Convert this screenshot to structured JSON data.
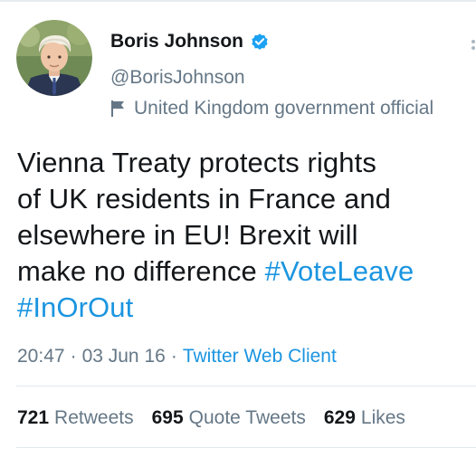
{
  "author": {
    "display_name": "Boris Johnson",
    "handle": "@BorisJohnson",
    "label": "United Kingdom government official",
    "avatar_icon": "person-portrait-icon",
    "verified_icon": "verified-badge-icon"
  },
  "tweet": {
    "lines": [
      "Vienna Treaty protects rights",
      "of UK residents in France and",
      "elsewhere in EU! Brexit will",
      "make no difference "
    ],
    "hashtags": [
      "#VoteLeave",
      "#InOrOut"
    ]
  },
  "meta": {
    "time": "20:47",
    "date": "03 Jun 16",
    "separator": "·",
    "client": "Twitter Web Client"
  },
  "stats": {
    "retweets_count": "721",
    "retweets_label": "Retweets",
    "quotes_count": "695",
    "quotes_label": "Quote Tweets",
    "likes_count": "629",
    "likes_label": "Likes"
  },
  "colors": {
    "link": "#1b95e0",
    "secondary_text": "#657786",
    "primary_text": "#14171a",
    "divider": "#e1e8ed"
  }
}
